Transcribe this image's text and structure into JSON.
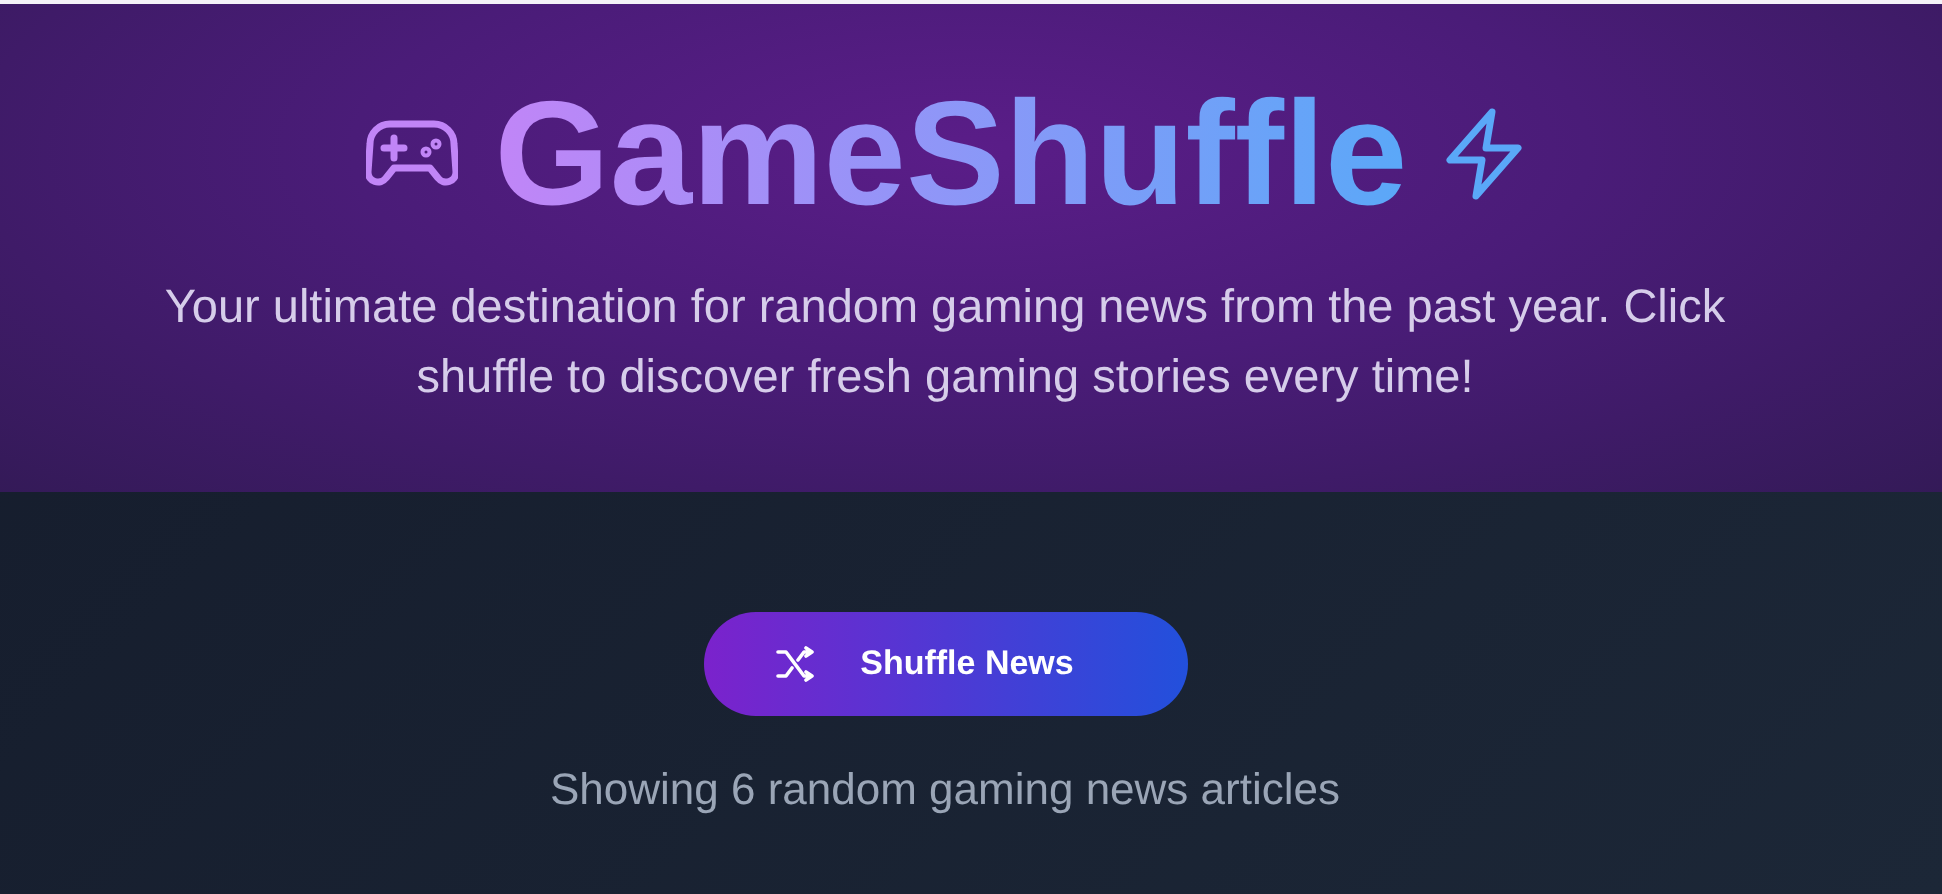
{
  "header": {
    "title": "GameShuffle",
    "tagline": "Your ultimate destination for random gaming news from the past year. Click shuffle to discover fresh gaming stories every time!"
  },
  "shuffle_button": {
    "label": "Shuffle News"
  },
  "status": "Showing 6 random gaming news articles"
}
